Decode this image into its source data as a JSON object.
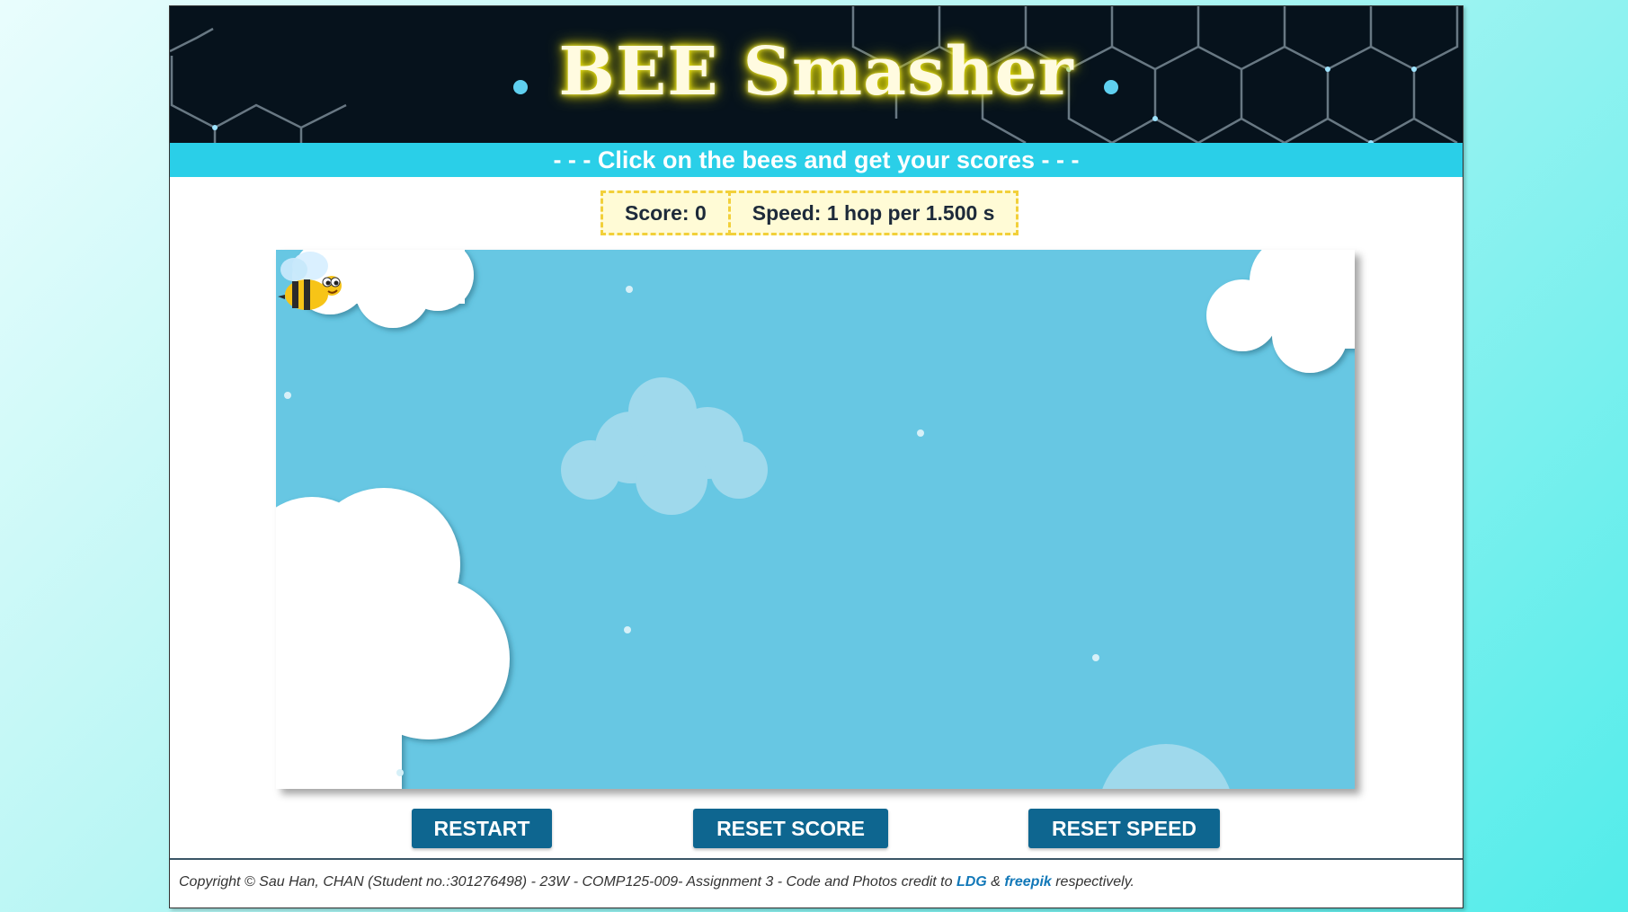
{
  "header": {
    "title": "BEE Smasher",
    "subtitle": "- - - Click on the bees and get your scores - - -"
  },
  "stats": {
    "score": "Score: 0",
    "speed": "Speed: 1 hop per 1.500 s"
  },
  "buttons": {
    "restart": "RESTART",
    "reset_score": "RESET SCORE",
    "reset_speed": "RESET SPEED"
  },
  "footer": {
    "text_before": "Copyright © Sau Han, CHAN (Student no.:301276498) - 23W - COMP125-009- Assignment 3 - Code and Photos credit to ",
    "link1": "LDG",
    "amp": " & ",
    "link2": "freepik",
    "text_after": " respectively."
  },
  "colors": {
    "header_bg": "#06121c",
    "subbar_bg": "#2acfe8",
    "sky": "#67c7e3",
    "button_bg": "#0e6690",
    "stat_bg": "#fffbd6",
    "stat_border": "#f2d03a"
  },
  "icons": {
    "bee": "bee-icon",
    "clouds": "cloud-icon"
  }
}
